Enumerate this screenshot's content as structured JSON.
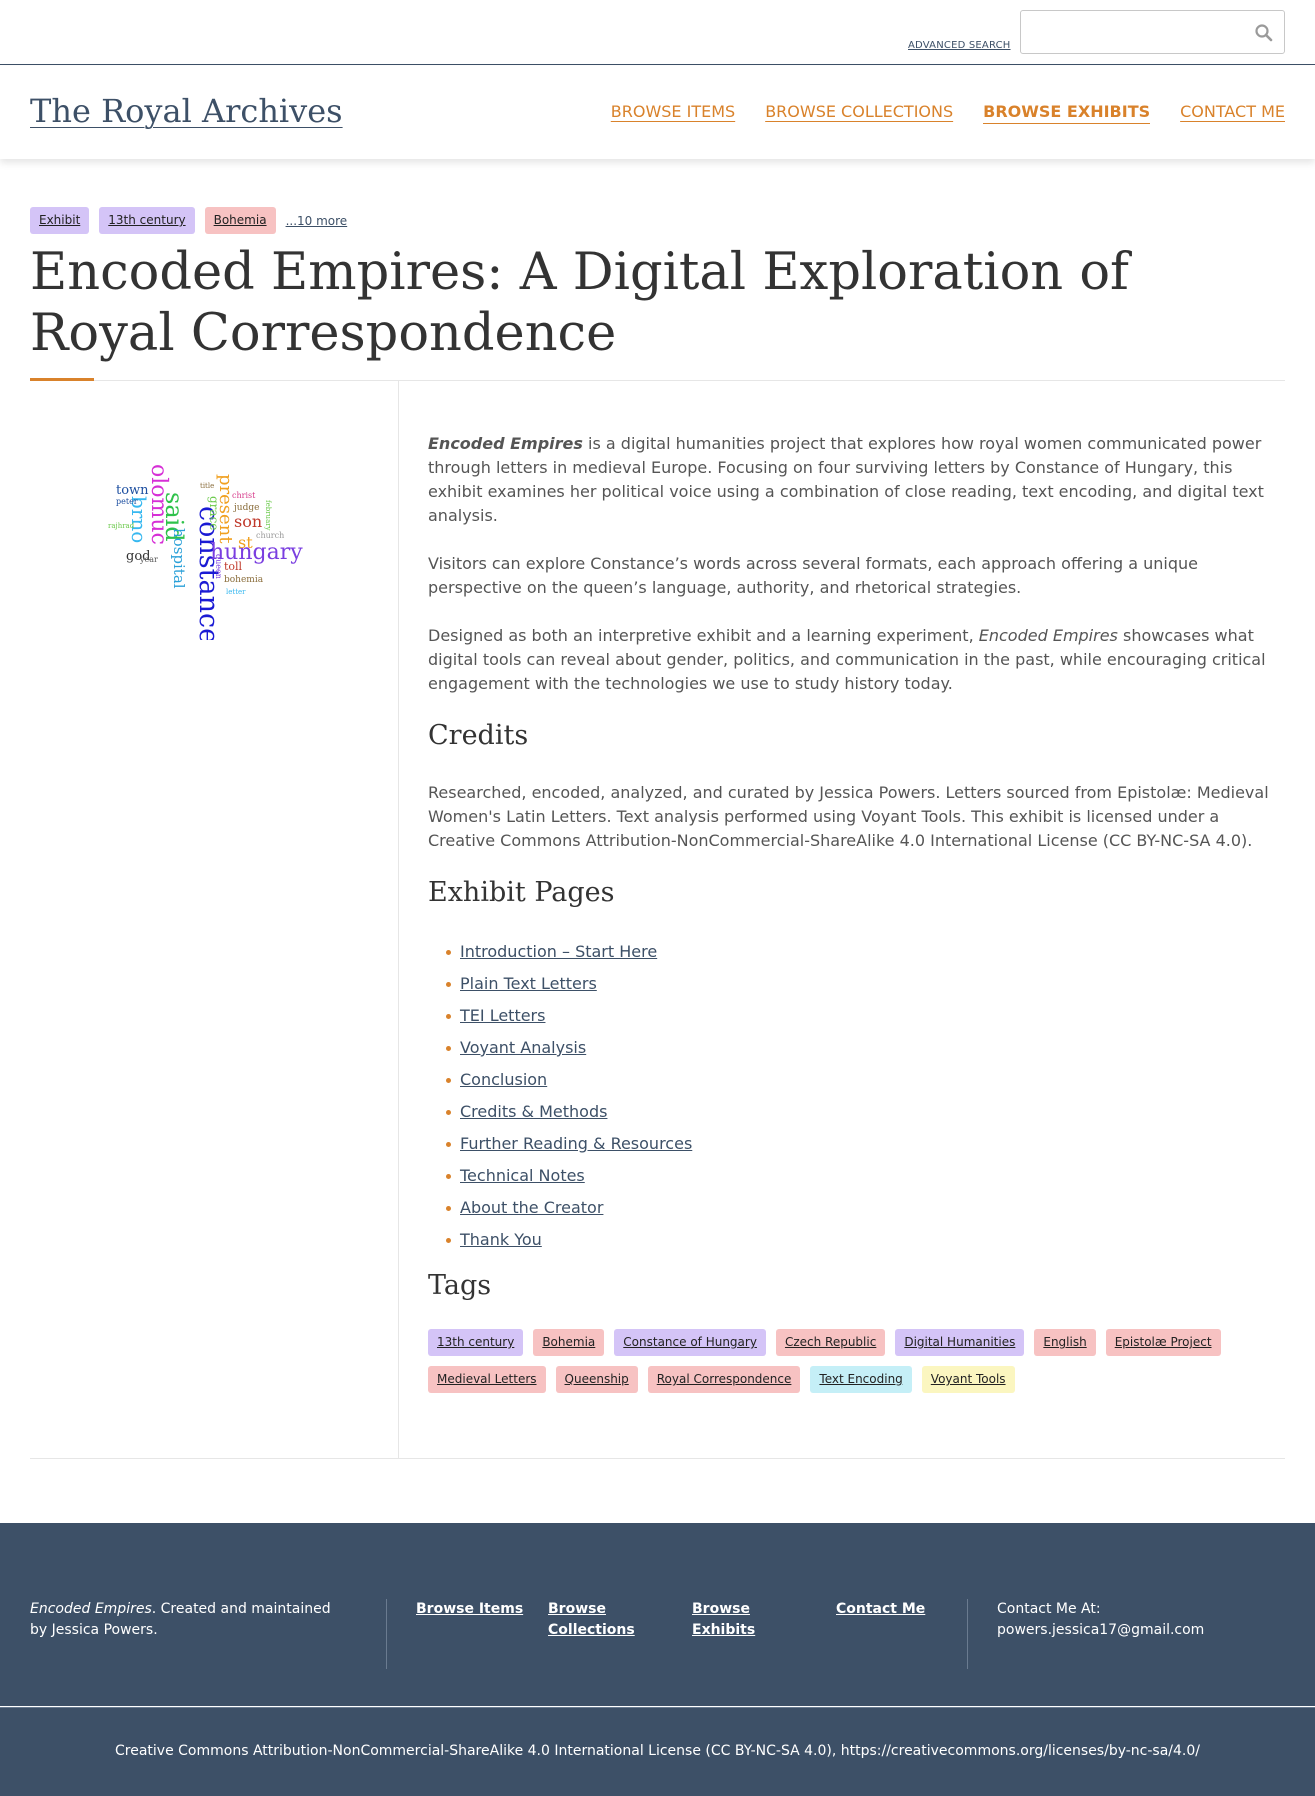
{
  "topbar": {
    "advanced_search": "ADVANCED SEARCH",
    "search_placeholder": ""
  },
  "header": {
    "site_title": "The Royal Archives",
    "nav": [
      {
        "label": "BROWSE ITEMS"
      },
      {
        "label": "BROWSE COLLECTIONS"
      },
      {
        "label": "BROWSE EXHIBITS"
      },
      {
        "label": "CONTACT ME"
      }
    ],
    "active_nav": "BROWSE EXHIBITS"
  },
  "top_tags": [
    {
      "label": "Exhibit",
      "color": "#d4c4f7"
    },
    {
      "label": "13th century",
      "color": "#d4c4f7"
    },
    {
      "label": "Bohemia",
      "color": "#f7c2c2"
    }
  ],
  "more_tags": "...10 more",
  "title": "Encoded Empires: A Digital Exploration of Royal Correspondence",
  "intro": {
    "p1_em": "Encoded Empires",
    "p1_rest": " is a digital humanities project that explores how royal women communicated power through letters in medieval Europe. Focusing on four surviving letters by Constance of Hungary, this exhibit examines her political voice using a combination of close reading, text encoding, and digital text analysis.",
    "p2": "Visitors can explore Constance’s words across several formats, each approach offering a unique perspective on the queen’s language, authority, and rhetorical strategies.",
    "p3_a": "Designed as both an interpretive exhibit and a learning experiment, ",
    "p3_em": "Encoded Empires",
    "p3_b": " showcases what digital tools can reveal about gender, politics, and communication in the past, while encouraging critical engagement with the technologies we use to study history today."
  },
  "credits": {
    "heading": "Credits",
    "text": "Researched, encoded, analyzed, and curated by Jessica Powers. Letters sourced from Epistolæ: Medieval Women's Latin Letters. Text analysis performed using Voyant Tools. This exhibit is licensed under a Creative Commons Attribution-NonCommercial-ShareAlike 4.0 International License (CC BY-NC-SA 4.0)."
  },
  "exhibit_pages": {
    "heading": "Exhibit Pages",
    "items": [
      "Introduction – Start Here",
      "Plain Text Letters",
      "TEI Letters",
      "Voyant Analysis",
      "Conclusion",
      "Credits & Methods",
      "Further Reading & Resources",
      "Technical Notes",
      "About the Creator",
      "Thank You"
    ]
  },
  "tags": {
    "heading": "Tags",
    "items": [
      {
        "label": "13th century",
        "color": "#d4c4f7"
      },
      {
        "label": "Bohemia",
        "color": "#f7c2c2"
      },
      {
        "label": "Constance of Hungary",
        "color": "#d4c4f7"
      },
      {
        "label": "Czech Republic",
        "color": "#f7c2c2"
      },
      {
        "label": "Digital Humanities",
        "color": "#d4c4f7"
      },
      {
        "label": "English",
        "color": "#f7c2c2"
      },
      {
        "label": "Epistolæ Project",
        "color": "#f7c2c2"
      },
      {
        "label": "Medieval Letters",
        "color": "#f7c2c2"
      },
      {
        "label": "Queenship",
        "color": "#f7c2c2"
      },
      {
        "label": "Royal Correspondence",
        "color": "#f7c2c2"
      },
      {
        "label": "Text Encoding",
        "color": "#c5eff7"
      },
      {
        "label": "Voyant Tools",
        "color": "#fbf6c0"
      }
    ]
  },
  "wordcloud": {
    "words": [
      {
        "text": "constance",
        "color": "#1a1ad4"
      },
      {
        "text": "hungary",
        "color": "#7a3ee0"
      },
      {
        "text": "said",
        "color": "#2ec24a"
      },
      {
        "text": "olomuc",
        "color": "#d62fd6"
      },
      {
        "text": "brno",
        "color": "#37b8f0"
      },
      {
        "text": "hospital",
        "color": "#2aa0d8"
      },
      {
        "text": "present",
        "color": "#f0a020"
      },
      {
        "text": "son",
        "color": "#c0392b"
      },
      {
        "text": "town",
        "color": "#1d4fa0"
      },
      {
        "text": "god",
        "color": "#333333"
      },
      {
        "text": "grace",
        "color": "#6ac94a"
      },
      {
        "text": "toll",
        "color": "#c0392b"
      },
      {
        "text": "judge",
        "color": "#8a6d3b"
      },
      {
        "text": "christ",
        "color": "#d63a8a"
      },
      {
        "text": "bohemia",
        "color": "#8a6d3b"
      },
      {
        "text": "queen",
        "color": "#7a3ee0"
      },
      {
        "text": "peter",
        "color": "#1d4fa0"
      },
      {
        "text": "year",
        "color": "#555555"
      },
      {
        "text": "church",
        "color": "#999999"
      },
      {
        "text": "letter",
        "color": "#37b8f0"
      },
      {
        "text": "title",
        "color": "#8a6d3b"
      },
      {
        "text": "february",
        "color": "#6ac94a"
      },
      {
        "text": "rajhrad",
        "color": "#6ac94a"
      },
      {
        "text": "st",
        "color": "#f0a020"
      }
    ]
  },
  "footer": {
    "about_em": "Encoded Empires",
    "about_rest": ". Created and maintained by Jessica Powers.",
    "links": [
      {
        "label": "Browse Items"
      },
      {
        "label": "Browse Collections"
      },
      {
        "label": "Browse Exhibits"
      },
      {
        "label": "Contact Me"
      }
    ],
    "contact_label": "Contact Me At:",
    "contact_email": "powers.jessica17@gmail.com",
    "license": "Creative Commons Attribution-NonCommercial-ShareAlike 4.0 International License (CC BY-NC-SA 4.0), https://creativecommons.org/licenses/by-nc-sa/4.0/"
  },
  "colors": {
    "accent": "#d9822b",
    "navy": "#3d5067",
    "tag_purple": "#d4c4f7",
    "tag_red": "#f7c2c2",
    "tag_cyan": "#c5eff7",
    "tag_yellow": "#fbf6c0"
  }
}
